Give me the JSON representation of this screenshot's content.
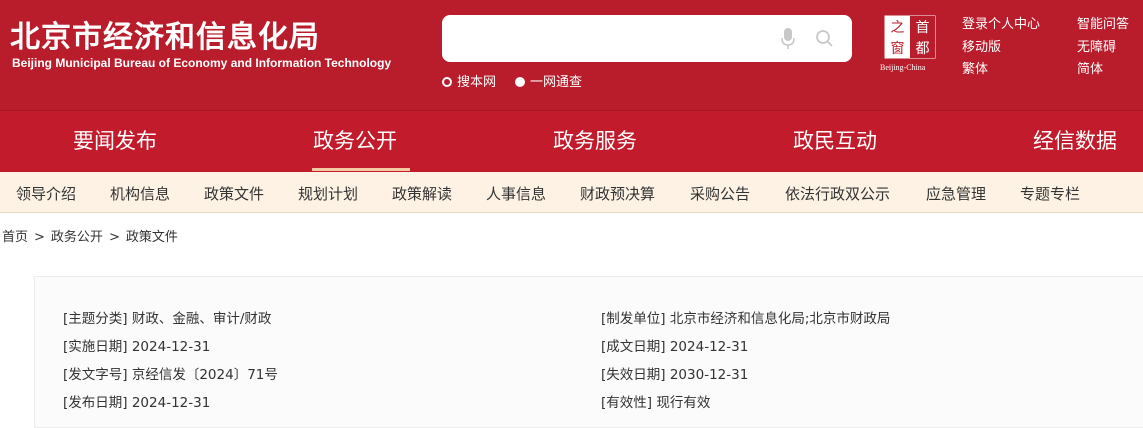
{
  "header": {
    "title_cn": "北京市经济和信息化局",
    "title_en": "Beijing Municipal Bureau of Economy and Information Technology",
    "search": {
      "placeholder": "",
      "value": ""
    },
    "scopes": [
      {
        "label": "搜本网",
        "selected": false
      },
      {
        "label": "一网通查",
        "selected": true
      }
    ],
    "seal": {
      "chars": [
        "首",
        "都",
        "之",
        "窗"
      ],
      "caption": "Beijing-China"
    },
    "links": {
      "login": "登录个人中心",
      "mobile": "移动版",
      "traditional": "繁体",
      "smart_qa": "智能问答",
      "accessible": "无障碍",
      "simplified": "简体"
    },
    "colors": {
      "brand_red": "#b91c2b",
      "nav_red": "#c21b2c",
      "subnav_bg": "#fdf2e4",
      "active_underline": "#f3c9a2"
    }
  },
  "main_nav": {
    "items": [
      "要闻发布",
      "政务公开",
      "政务服务",
      "政民互动",
      "经信数据"
    ],
    "active": "政务公开"
  },
  "sub_nav": {
    "items": [
      "领导介绍",
      "机构信息",
      "政策文件",
      "规划计划",
      "政策解读",
      "人事信息",
      "财政预决算",
      "采购公告",
      "依法行政双公示",
      "应急管理",
      "专题专栏"
    ]
  },
  "breadcrumb": {
    "home": "首页",
    "level1": "政务公开",
    "level2": "政策文件",
    "separator": ">"
  },
  "meta": {
    "topic": {
      "key": "[主题分类]",
      "value": "财政、金融、审计/财政"
    },
    "issuer": {
      "key": "[制发单位]",
      "value": "北京市经济和信息化局;北京市财政局"
    },
    "impl": {
      "key": "[实施日期]",
      "value": "2024-12-31"
    },
    "written": {
      "key": "[成文日期]",
      "value": "2024-12-31"
    },
    "docno": {
      "key": "[发文字号]",
      "value": "京经信发〔2024〕71号"
    },
    "expiry": {
      "key": "[失效日期]",
      "value": "2030-12-31"
    },
    "publish": {
      "key": "[发布日期]",
      "value": "2024-12-31"
    },
    "validity": {
      "key": "[有效性]",
      "value": "现行有效"
    }
  }
}
